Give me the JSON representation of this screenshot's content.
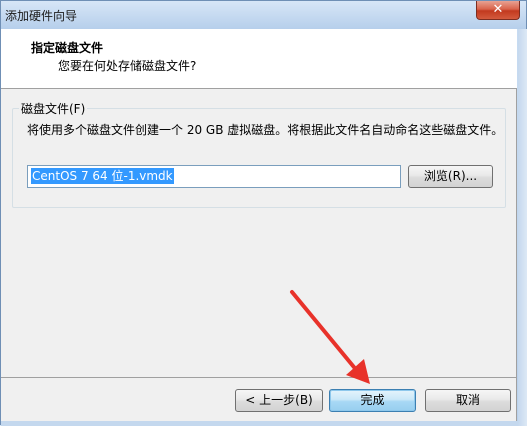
{
  "window": {
    "title": "添加硬件向导",
    "close_glyph": "✕"
  },
  "header": {
    "title": "指定磁盘文件",
    "subtitle": "您要在何处存储磁盘文件?"
  },
  "group": {
    "label": "磁盘文件(F)",
    "description": "将使用多个磁盘文件创建一个 20 GB 虚拟磁盘。将根据此文件名自动命名这些磁盘文件。",
    "file_value": "CentOS 7 64 位-1.vmdk",
    "browse_label": "浏览(R)..."
  },
  "buttons": {
    "back_label": "< 上一步(B)",
    "finish_label": "完成",
    "cancel_label": "取消"
  },
  "annotation": {
    "arrow_color": "#e8322a"
  }
}
